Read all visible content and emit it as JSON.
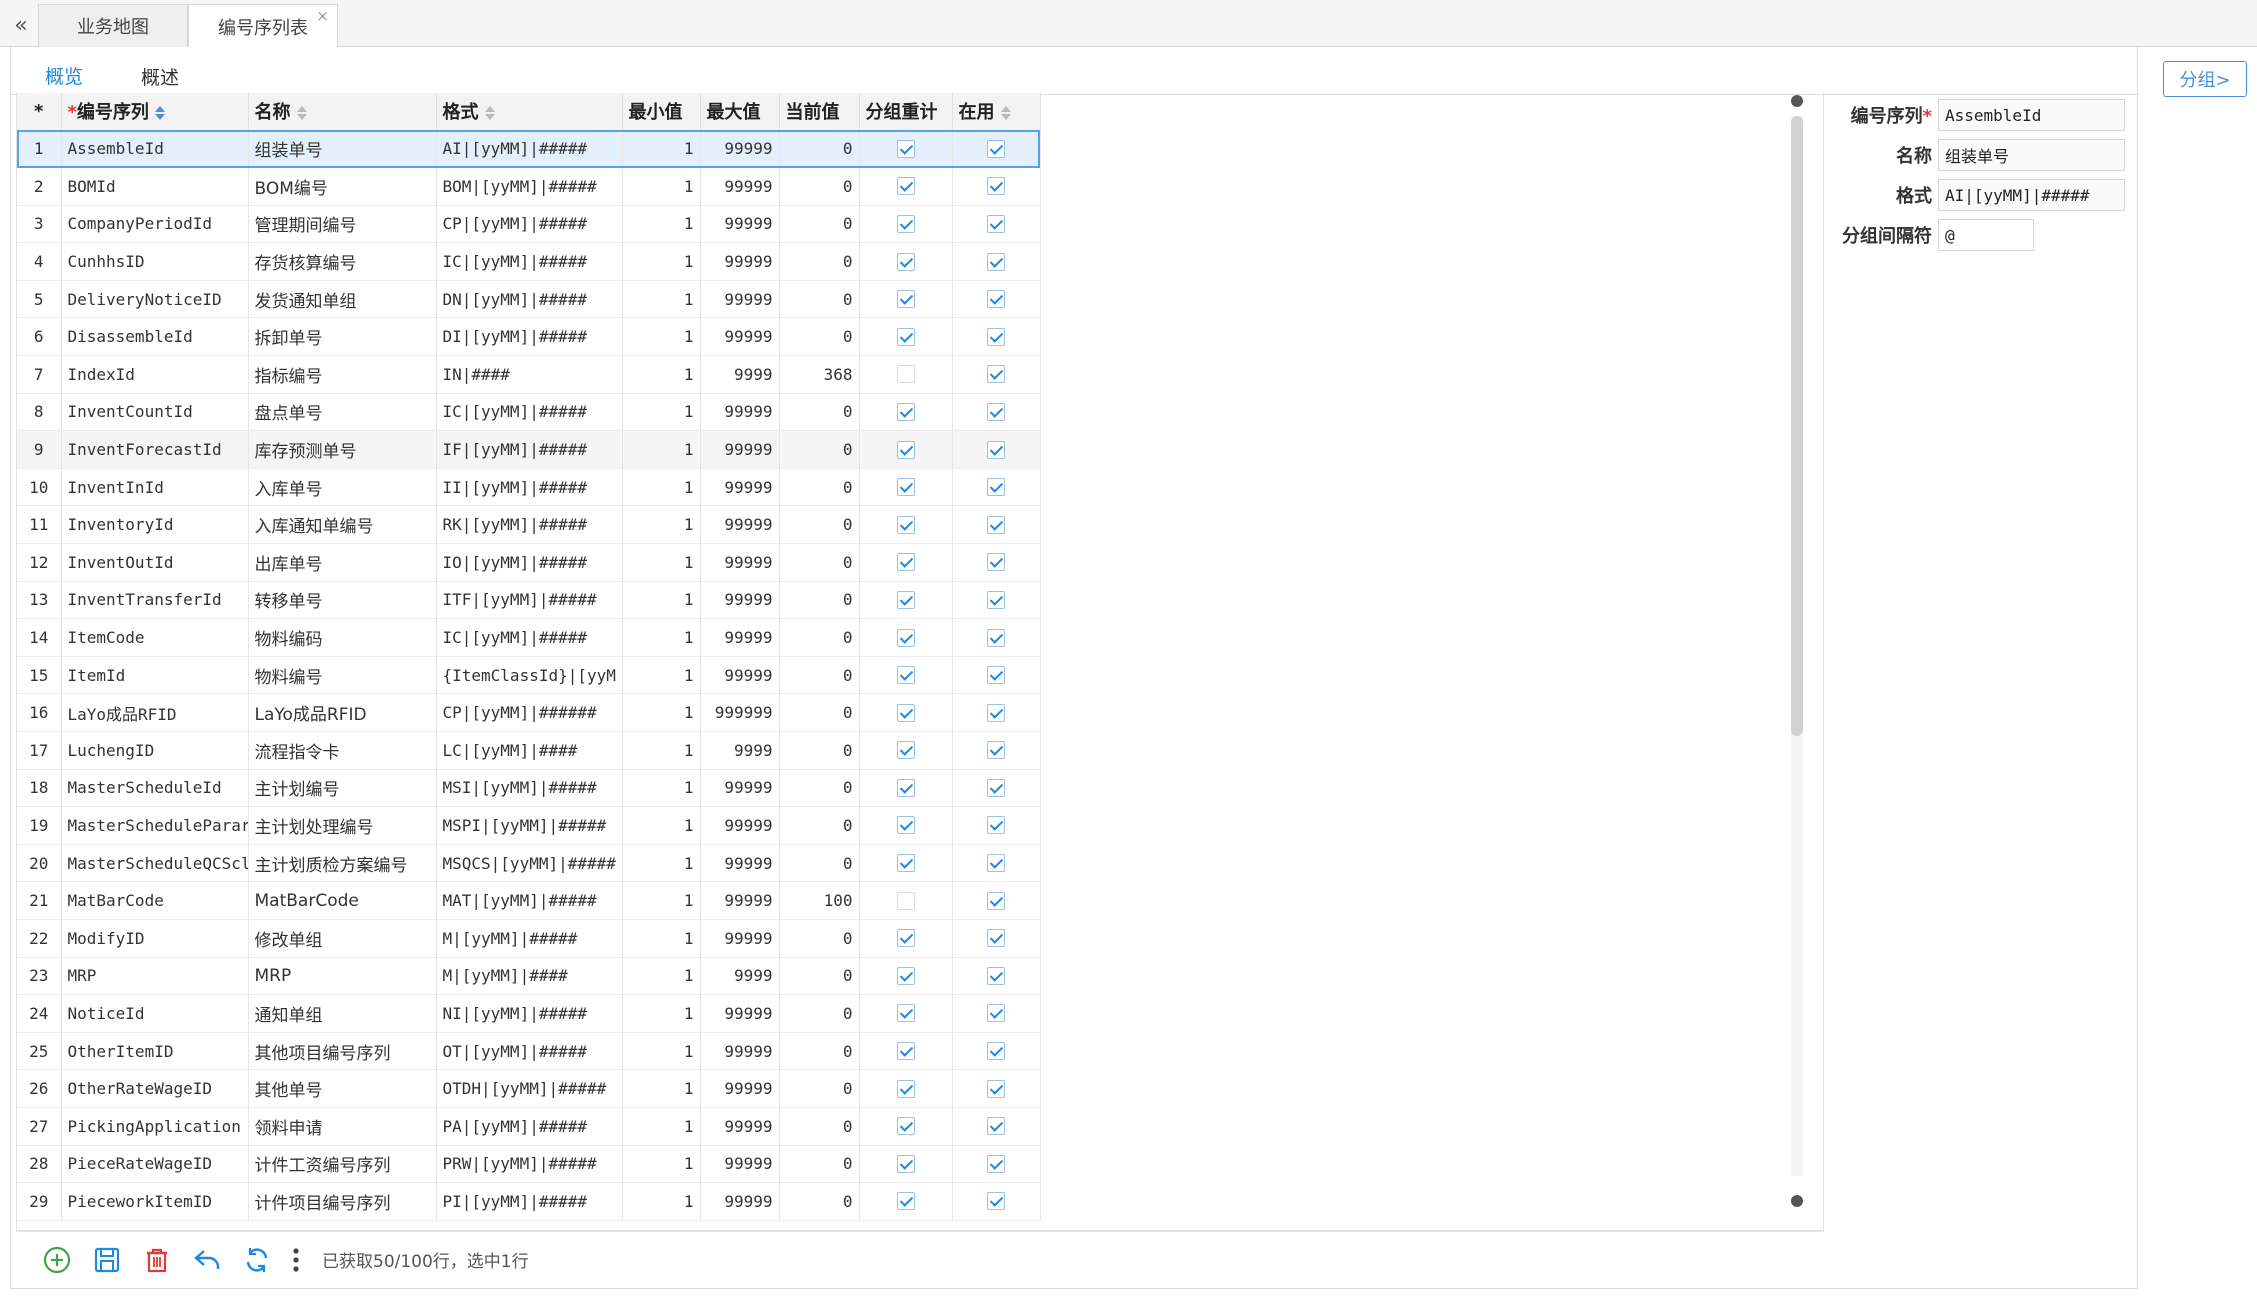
{
  "page_tabs": [
    {
      "label": "业务地图",
      "active": false
    },
    {
      "label": "编号序列表",
      "active": true,
      "close": "×"
    }
  ],
  "collapse_glyph": "«",
  "sub_tabs": [
    {
      "label": "概览",
      "active": true
    },
    {
      "label": "概述",
      "active": false
    }
  ],
  "grid": {
    "corner": "*",
    "required_mark": "*",
    "columns": [
      "编号序列",
      "名称",
      "格式",
      "最小值",
      "最大值",
      "当前值",
      "分组重计",
      "在用"
    ],
    "rows": [
      {
        "n": "1",
        "code": "AssembleId",
        "name": "组装单号",
        "format": "AI|[yyMM]|#####",
        "min": "1",
        "max": "99999",
        "cur": "0",
        "regroup": true,
        "inuse": true
      },
      {
        "n": "2",
        "code": "BOMId",
        "name": "BOM编号",
        "format": "BOM|[yyMM]|#####",
        "min": "1",
        "max": "99999",
        "cur": "0",
        "regroup": true,
        "inuse": true
      },
      {
        "n": "3",
        "code": "CompanyPeriodId",
        "name": "管理期间编号",
        "format": "CP|[yyMM]|#####",
        "min": "1",
        "max": "99999",
        "cur": "0",
        "regroup": true,
        "inuse": true
      },
      {
        "n": "4",
        "code": "CunhhsID",
        "name": "存货核算编号",
        "format": "IC|[yyMM]|#####",
        "min": "1",
        "max": "99999",
        "cur": "0",
        "regroup": true,
        "inuse": true
      },
      {
        "n": "5",
        "code": "DeliveryNoticeID",
        "name": "发货通知单组",
        "format": "DN|[yyMM]|#####",
        "min": "1",
        "max": "99999",
        "cur": "0",
        "regroup": true,
        "inuse": true
      },
      {
        "n": "6",
        "code": "DisassembleId",
        "name": "拆卸单号",
        "format": "DI|[yyMM]|#####",
        "min": "1",
        "max": "99999",
        "cur": "0",
        "regroup": true,
        "inuse": true
      },
      {
        "n": "7",
        "code": "IndexId",
        "name": "指标编号",
        "format": "IN|####",
        "min": "1",
        "max": "9999",
        "cur": "368",
        "regroup": false,
        "inuse": true
      },
      {
        "n": "8",
        "code": "InventCountId",
        "name": "盘点单号",
        "format": "IC|[yyMM]|#####",
        "min": "1",
        "max": "99999",
        "cur": "0",
        "regroup": true,
        "inuse": true
      },
      {
        "n": "9",
        "code": "InventForecastId",
        "name": "库存预测单号",
        "format": "IF|[yyMM]|#####",
        "min": "1",
        "max": "99999",
        "cur": "0",
        "regroup": true,
        "inuse": true
      },
      {
        "n": "10",
        "code": "InventInId",
        "name": "入库单号",
        "format": "II|[yyMM]|#####",
        "min": "1",
        "max": "99999",
        "cur": "0",
        "regroup": true,
        "inuse": true
      },
      {
        "n": "11",
        "code": "InventoryId",
        "name": "入库通知单编号",
        "format": "RK|[yyMM]|#####",
        "min": "1",
        "max": "99999",
        "cur": "0",
        "regroup": true,
        "inuse": true
      },
      {
        "n": "12",
        "code": "InventOutId",
        "name": "出库单号",
        "format": "IO|[yyMM]|#####",
        "min": "1",
        "max": "99999",
        "cur": "0",
        "regroup": true,
        "inuse": true
      },
      {
        "n": "13",
        "code": "InventTransferId",
        "name": "转移单号",
        "format": "ITF|[yyMM]|#####",
        "min": "1",
        "max": "99999",
        "cur": "0",
        "regroup": true,
        "inuse": true
      },
      {
        "n": "14",
        "code": "ItemCode",
        "name": "物料编码",
        "format": "IC|[yyMM]|#####",
        "min": "1",
        "max": "99999",
        "cur": "0",
        "regroup": true,
        "inuse": true
      },
      {
        "n": "15",
        "code": "ItemId",
        "name": "物料编号",
        "format": "{ItemClassId}|[yyM",
        "min": "1",
        "max": "99999",
        "cur": "0",
        "regroup": true,
        "inuse": true
      },
      {
        "n": "16",
        "code": "LaYo成品RFID",
        "name": "LaYo成品RFID",
        "format": "CP|[yyMM]|######",
        "min": "1",
        "max": "999999",
        "cur": "0",
        "regroup": true,
        "inuse": true
      },
      {
        "n": "17",
        "code": "LuchengID",
        "name": "流程指令卡",
        "format": "LC|[yyMM]|####",
        "min": "1",
        "max": "9999",
        "cur": "0",
        "regroup": true,
        "inuse": true
      },
      {
        "n": "18",
        "code": "MasterScheduleId",
        "name": "主计划编号",
        "format": "MSI|[yyMM]|#####",
        "min": "1",
        "max": "99999",
        "cur": "0",
        "regroup": true,
        "inuse": true
      },
      {
        "n": "19",
        "code": "MasterScheduleParar",
        "name": "主计划处理编号",
        "format": "MSPI|[yyMM]|#####",
        "min": "1",
        "max": "99999",
        "cur": "0",
        "regroup": true,
        "inuse": true
      },
      {
        "n": "20",
        "code": "MasterScheduleQCScl",
        "name": "主计划质检方案编号",
        "format": "MSQCS|[yyMM]|#####",
        "min": "1",
        "max": "99999",
        "cur": "0",
        "regroup": true,
        "inuse": true
      },
      {
        "n": "21",
        "code": "MatBarCode",
        "name": "MatBarCode",
        "format": "MAT|[yyMM]|#####",
        "min": "1",
        "max": "99999",
        "cur": "100",
        "regroup": false,
        "inuse": true
      },
      {
        "n": "22",
        "code": "ModifyID",
        "name": "修改单组",
        "format": "M|[yyMM]|#####",
        "min": "1",
        "max": "99999",
        "cur": "0",
        "regroup": true,
        "inuse": true
      },
      {
        "n": "23",
        "code": "MRP",
        "name": "MRP",
        "format": "M|[yyMM]|####",
        "min": "1",
        "max": "9999",
        "cur": "0",
        "regroup": true,
        "inuse": true
      },
      {
        "n": "24",
        "code": "NoticeId",
        "name": "通知单组",
        "format": "NI|[yyMM]|#####",
        "min": "1",
        "max": "99999",
        "cur": "0",
        "regroup": true,
        "inuse": true
      },
      {
        "n": "25",
        "code": "OtherItemID",
        "name": "其他项目编号序列",
        "format": "OT|[yyMM]|#####",
        "min": "1",
        "max": "99999",
        "cur": "0",
        "regroup": true,
        "inuse": true
      },
      {
        "n": "26",
        "code": "OtherRateWageID",
        "name": "其他单号",
        "format": "OTDH|[yyMM]|#####",
        "min": "1",
        "max": "99999",
        "cur": "0",
        "regroup": true,
        "inuse": true
      },
      {
        "n": "27",
        "code": "PickingApplication",
        "name": "领料申请",
        "format": "PA|[yyMM]|#####",
        "min": "1",
        "max": "99999",
        "cur": "0",
        "regroup": true,
        "inuse": true
      },
      {
        "n": "28",
        "code": "PieceRateWageID",
        "name": "计件工资编号序列",
        "format": "PRW|[yyMM]|#####",
        "min": "1",
        "max": "99999",
        "cur": "0",
        "regroup": true,
        "inuse": true
      },
      {
        "n": "29",
        "code": "PieceworkItemID",
        "name": "计件项目编号序列",
        "format": "PI|[yyMM]|#####",
        "min": "1",
        "max": "99999",
        "cur": "0",
        "regroup": true,
        "inuse": true
      }
    ]
  },
  "toolbar": {
    "status": "已获取50/100行，选中1行"
  },
  "form": {
    "code_label": "编号序列",
    "code_value": "AssembleId",
    "name_label": "名称",
    "name_value": "组装单号",
    "format_label": "格式",
    "format_value": "AI|[yyMM]|#####",
    "separator_label": "分组间隔符",
    "separator_value": "@"
  },
  "group_button": "分组>",
  "colors": {
    "accent": "#1e88e5",
    "add": "#43a047",
    "save": "#1e88e5",
    "delete": "#e53935",
    "required": "#e53935"
  }
}
